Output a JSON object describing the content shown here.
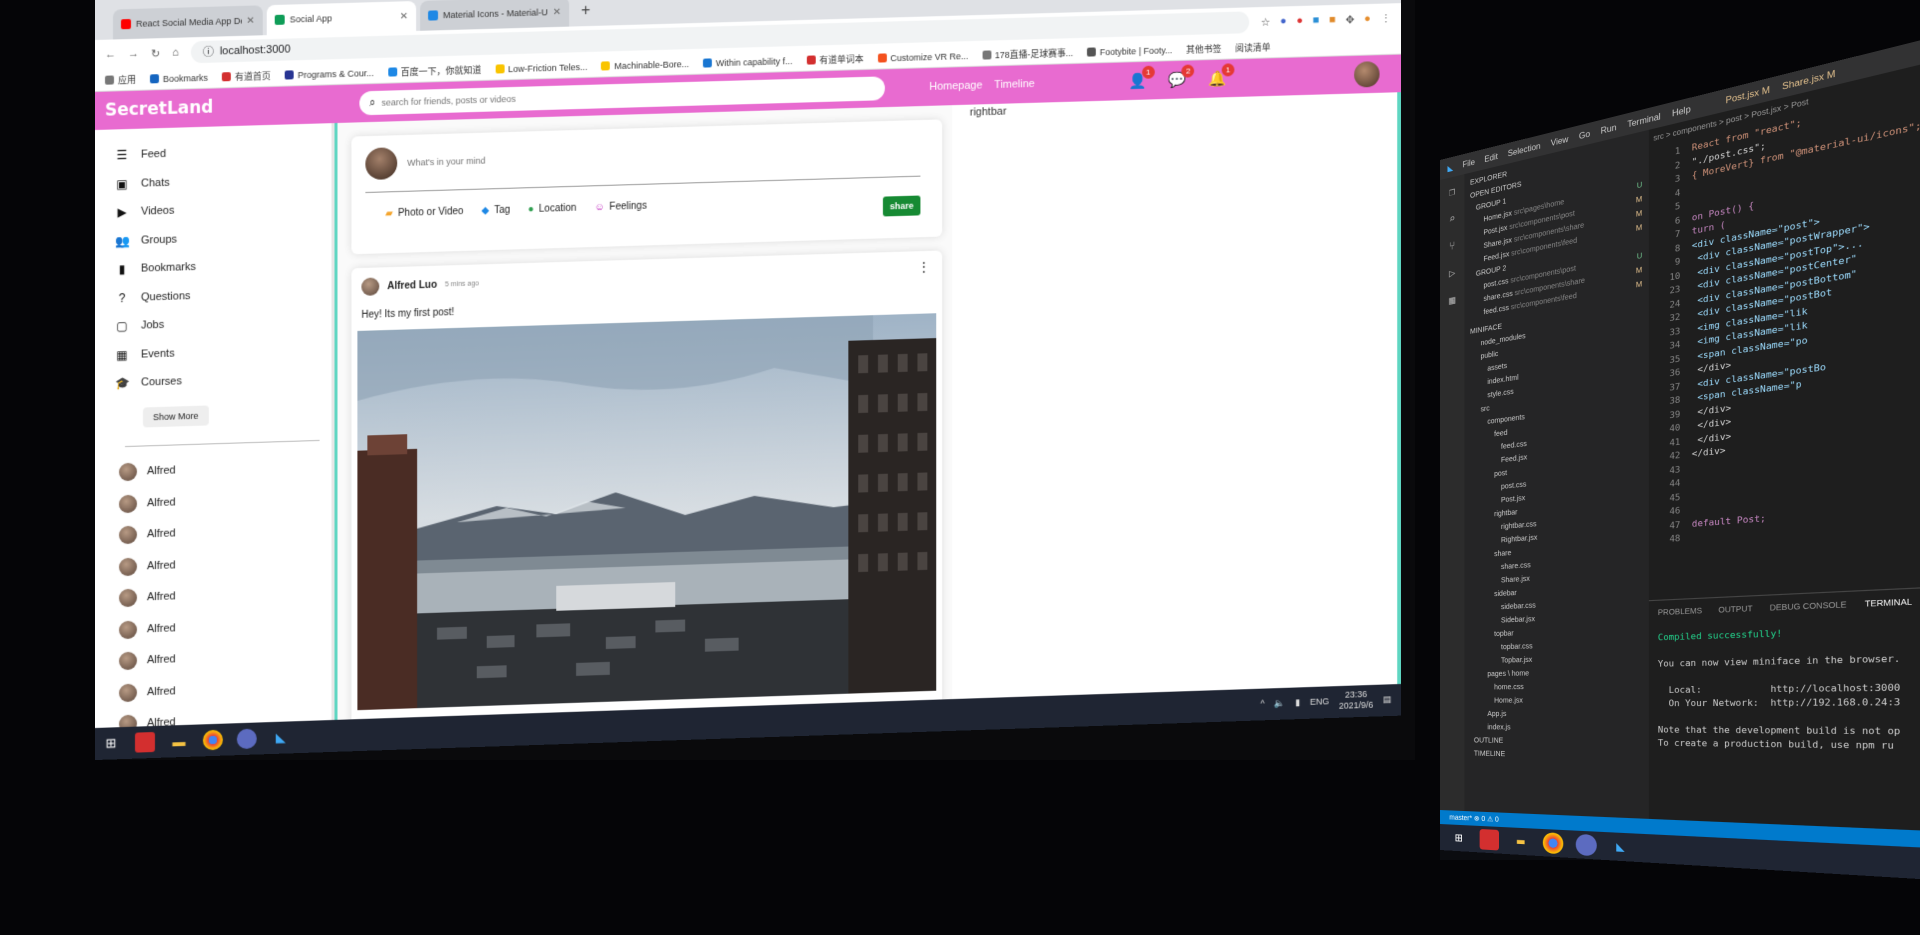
{
  "browser": {
    "tabs": [
      {
        "title": "React Social Media App Desi...",
        "color": "#ff0000"
      },
      {
        "title": "Social App",
        "color": "#0f9d58"
      },
      {
        "title": "Material Icons - Material-UI",
        "color": "#1e88e5"
      }
    ],
    "new_tab": "+",
    "url": "localhost:3000",
    "bookmarks": [
      "应用",
      "Bookmarks",
      "有道首页",
      "Programs & Cour...",
      "百度一下，你就知道",
      "Low-Friction Teles...",
      "Machinable-Bore...",
      "Within capability f...",
      "有道单词本",
      "Customize VR Re...",
      "178直播-足球赛事...",
      "Footybite | Footy..."
    ],
    "extras": [
      "其他书签",
      "阅读清单"
    ]
  },
  "topbar": {
    "logo": "SecretLand",
    "search_placeholder": "search for friends, posts or videos",
    "links": [
      "Homepage",
      "Timeline"
    ],
    "badges": {
      "person": "1",
      "chat": "2",
      "notifications": "1"
    },
    "accent_color": "#e86bd0"
  },
  "sidebar": {
    "items": [
      {
        "label": "Feed",
        "icon": "rss-icon"
      },
      {
        "label": "Chats",
        "icon": "chat-icon"
      },
      {
        "label": "Videos",
        "icon": "play-circle-icon"
      },
      {
        "label": "Groups",
        "icon": "group-icon"
      },
      {
        "label": "Bookmarks",
        "icon": "bookmark-icon"
      },
      {
        "label": "Questions",
        "icon": "help-icon"
      },
      {
        "label": "Jobs",
        "icon": "work-icon"
      },
      {
        "label": "Events",
        "icon": "event-icon"
      },
      {
        "label": "Courses",
        "icon": "school-icon"
      }
    ],
    "show_more": "Show More",
    "friends": [
      "Alfred",
      "Alfred",
      "Alfred",
      "Alfred",
      "Alfred",
      "Alfred",
      "Alfred",
      "Alfred",
      "Alfred"
    ]
  },
  "share": {
    "placeholder": "What's in your mind",
    "options": [
      {
        "label": "Photo or Video",
        "color": "#f4a52e",
        "icon": "photo-icon"
      },
      {
        "label": "Tag",
        "color": "#1e88e5",
        "icon": "label-icon"
      },
      {
        "label": "Location",
        "color": "#2e9e4f",
        "icon": "location-icon"
      },
      {
        "label": "Feelings",
        "color": "#c02fbf",
        "icon": "emoji-icon"
      }
    ],
    "button": "share",
    "button_color": "#168a33"
  },
  "post": {
    "author": "Alfred Luo",
    "date": "5 mins ago",
    "text": "Hey! Its my first post!"
  },
  "rightbar": {
    "label": "rightbar"
  },
  "taskbar": {
    "lang": "ENG",
    "time": "23:36",
    "date": "2021/9/6"
  },
  "vscode": {
    "menu": [
      "File",
      "Edit",
      "Selection",
      "View",
      "Go",
      "Run",
      "Terminal",
      "Help"
    ],
    "tabs": [
      "Post.jsx M",
      "Share.jsx M"
    ],
    "breadcrumb": "src > components > post > Post.jsx > Post",
    "explorer_title": "EXPLORER",
    "open_editors": "OPEN EDITORS",
    "group1": "GROUP 1",
    "group2": "GROUP 2",
    "project": "MINIFACE",
    "files": [
      {
        "name": "Home.jsx",
        "path": "src\\pages\\home",
        "status": "U"
      },
      {
        "name": "Post.jsx",
        "path": "src\\components\\post",
        "status": "M"
      },
      {
        "name": "Share.jsx",
        "path": "src\\components\\share",
        "status": "M"
      },
      {
        "name": "Feed.jsx",
        "path": "src\\components\\feed",
        "status": "M"
      },
      {
        "name": "post.css",
        "path": "src\\components\\post",
        "status": "U"
      },
      {
        "name": "share.css",
        "path": "src\\components\\share",
        "status": "M"
      },
      {
        "name": "feed.css",
        "path": "src\\components\\feed",
        "status": "M"
      }
    ],
    "tree": [
      "node_modules",
      "public",
      "assets",
      "index.html",
      "style.css",
      "src",
      "components",
      "feed",
      "feed.css",
      "Feed.jsx",
      "post",
      "post.css",
      "Post.jsx",
      "rightbar",
      "rightbar.css",
      "Rightbar.jsx",
      "share",
      "share.css",
      "Share.jsx",
      "sidebar",
      "sidebar.css",
      "Sidebar.jsx",
      "topbar",
      "topbar.css",
      "Topbar.jsx",
      "pages \\ home",
      "home.css",
      "Home.jsx",
      "App.js",
      "index.js",
      "OUTLINE",
      "TIMELINE"
    ],
    "code": [
      {
        "n": "1",
        "t": "React from \"react\";"
      },
      {
        "n": "2",
        "t": "\"./post.css\";"
      },
      {
        "n": "3",
        "t": "{ MoreVert} from \"@material-ui/icons\";"
      },
      {
        "n": "4",
        "t": ""
      },
      {
        "n": "5",
        "t": ""
      },
      {
        "n": "6",
        "t": "on Post() {"
      },
      {
        "n": "7",
        "t": "turn ("
      },
      {
        "n": "8",
        "t": "<div className=\"post\">"
      },
      {
        "n": "9",
        "t": "  <div className=\"postWrapper\">"
      },
      {
        "n": "10",
        "t": "    <div className=\"postTop\">..."
      },
      {
        "n": "23",
        "t": "    <div className=\"postCenter\""
      },
      {
        "n": "24",
        "t": "    <div className=\"postBottom\""
      },
      {
        "n": "32",
        "t": "      <div className=\"postBot"
      },
      {
        "n": "33",
        "t": "        <img className=\"lik"
      },
      {
        "n": "34",
        "t": "        <img className=\"lik"
      },
      {
        "n": "35",
        "t": "        <span className=\"po"
      },
      {
        "n": "36",
        "t": "      </div>"
      },
      {
        "n": "37",
        "t": "      <div className=\"postBo"
      },
      {
        "n": "38",
        "t": "        <span className=\"p"
      },
      {
        "n": "39",
        "t": "      </div>"
      },
      {
        "n": "40",
        "t": "    </div>"
      },
      {
        "n": "41",
        "t": "  </div>"
      },
      {
        "n": "42",
        "t": "</div>"
      },
      {
        "n": "43",
        "t": ""
      },
      {
        "n": "44",
        "t": ""
      },
      {
        "n": "45",
        "t": ""
      },
      {
        "n": "46",
        "t": ""
      },
      {
        "n": "47",
        "t": "default Post;"
      },
      {
        "n": "48",
        "t": ""
      }
    ],
    "panel_tabs": [
      "PROBLEMS",
      "OUTPUT",
      "DEBUG CONSOLE",
      "TERMINAL"
    ],
    "terminal": [
      "Compiled successfully!",
      "",
      "You can now view miniface in the browser.",
      "",
      "  Local:            http://localhost:3000",
      "  On Your Network:  http://192.168.0.24:3",
      "",
      "Note that the development build is not op",
      "To create a production build, use npm ru"
    ],
    "status": "master*   ⊗ 0 ⚠ 0"
  }
}
